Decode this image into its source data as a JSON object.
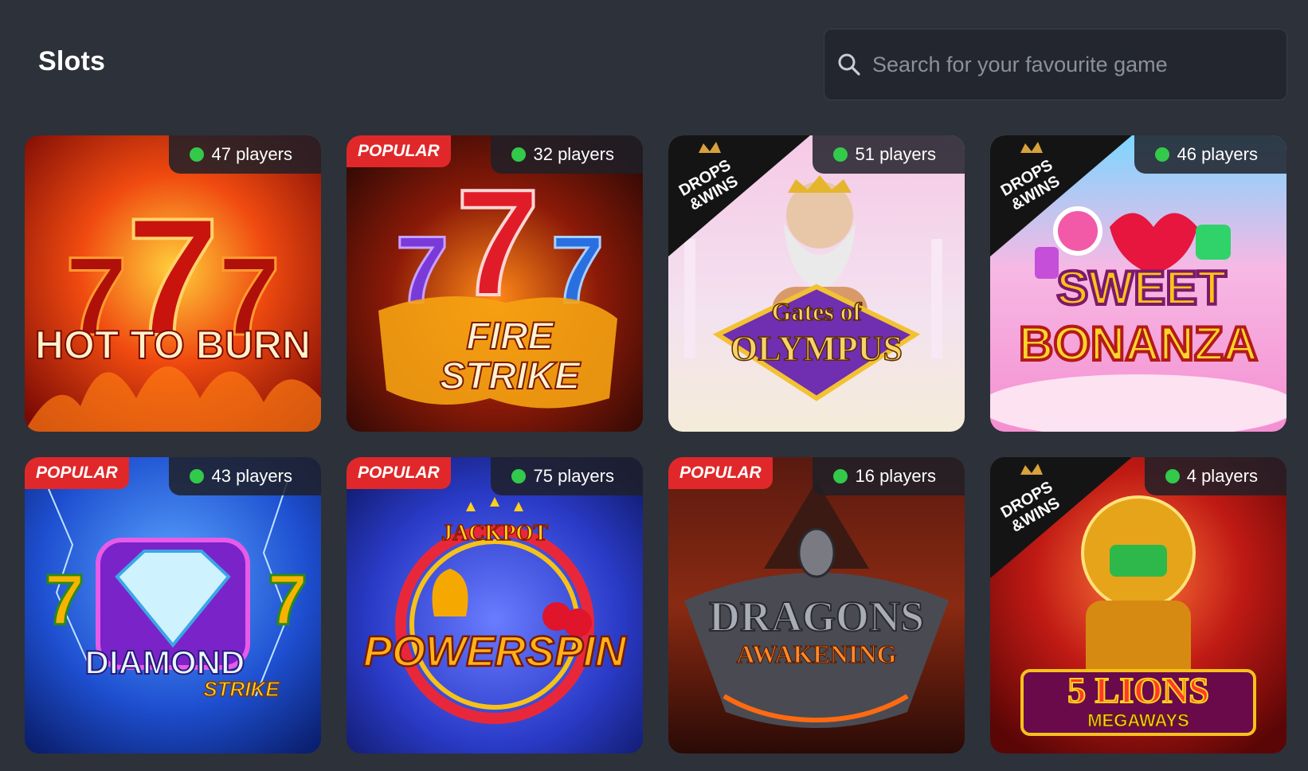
{
  "page": {
    "title": "Slots"
  },
  "search": {
    "placeholder": "Search for your favourite game",
    "icon": "search-icon"
  },
  "games": [
    {
      "title_line1": "HOT TO BURN",
      "title_line2": "",
      "players": "47 players",
      "popular": "",
      "drops": false
    },
    {
      "title_line1": "FIRE",
      "title_line2": "STRIKE",
      "players": "32 players",
      "popular": "POPULAR",
      "drops": false
    },
    {
      "title_line1": "Gates of",
      "title_line2": "OLYMPUS",
      "players": "51 players",
      "popular": "",
      "drops": true
    },
    {
      "title_line1": "SWEET",
      "title_line2": "BONANZA",
      "players": "46 players",
      "popular": "",
      "drops": true
    },
    {
      "title_line1": "DIAMOND",
      "title_line2": "STRIKE",
      "players": "43 players",
      "popular": "POPULAR",
      "drops": false
    },
    {
      "title_line1": "JACKPOT",
      "title_line2": "POWERSPIN",
      "players": "75 players",
      "popular": "POPULAR",
      "drops": false
    },
    {
      "title_line1": "DRAGONS",
      "title_line2": "AWAKENING",
      "players": "16 players",
      "popular": "POPULAR",
      "drops": false
    },
    {
      "title_line1": "5 LIONS",
      "title_line2": "MEGAWAYS",
      "players": "4 players",
      "popular": "",
      "drops": true
    }
  ],
  "drops_badge": {
    "line1": "DROPS",
    "line2": "&WINS"
  },
  "colors": {
    "background": "#2d313a",
    "online_dot": "#33c94b",
    "popular_badge": "#e0282a"
  }
}
